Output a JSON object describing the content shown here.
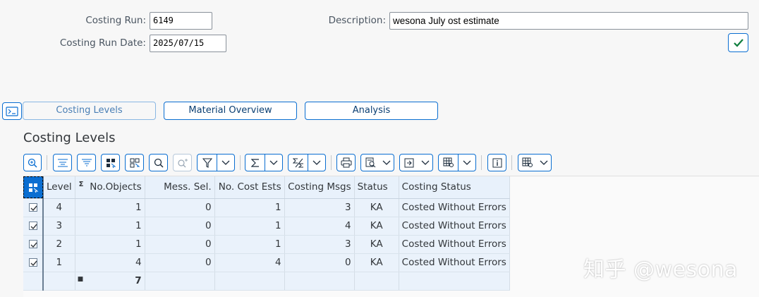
{
  "header": {
    "costing_run_label": "Costing Run:",
    "costing_run_value": "6149",
    "costing_run_date_label": "Costing Run Date:",
    "costing_run_date_value": "2025/07/15",
    "description_label": "Description:",
    "description_value": "wesona July ost estimate"
  },
  "tabs": [
    {
      "label": "Costing Levels"
    },
    {
      "label": "Material Overview"
    },
    {
      "label": "Analysis"
    }
  ],
  "section_title": "Costing Levels",
  "toolbar_icons": [
    "zoom-icon",
    "align-top-icon",
    "filter-lines-icon",
    "select-layout-icon",
    "layout-icon",
    "search-icon",
    "search-next-icon",
    "filter-icon",
    "sum-icon",
    "subtotal-icon",
    "print-icon",
    "view-icon",
    "export-icon",
    "grid-settings-icon",
    "info-icon",
    "layout-settings-icon"
  ],
  "table": {
    "columns": [
      "Level",
      "Σ",
      "No.Objects",
      "Mess. Sel.",
      "No. Cost Ests",
      "Costing Msgs",
      "Status",
      "Costing Status"
    ],
    "rows": [
      {
        "level": "4",
        "objects": "1",
        "mess_sel": "0",
        "cost_ests": "1",
        "msgs": "3",
        "status": "KA",
        "costing_status": "Costed Without Errors"
      },
      {
        "level": "3",
        "objects": "1",
        "mess_sel": "0",
        "cost_ests": "1",
        "msgs": "4",
        "status": "KA",
        "costing_status": "Costed Without Errors"
      },
      {
        "level": "2",
        "objects": "1",
        "mess_sel": "0",
        "cost_ests": "1",
        "msgs": "3",
        "status": "KA",
        "costing_status": "Costed Without Errors"
      },
      {
        "level": "1",
        "objects": "4",
        "mess_sel": "0",
        "cost_ests": "4",
        "msgs": "0",
        "status": "KA",
        "costing_status": "Costed Without Errors"
      }
    ],
    "total_marker": "■",
    "total_objects": "7"
  },
  "watermark": "知乎 @wesona",
  "colors": {
    "accent": "#0a6ed1",
    "grid_bg": "#eaf2fb",
    "header_bg": "#e8f1fb"
  }
}
